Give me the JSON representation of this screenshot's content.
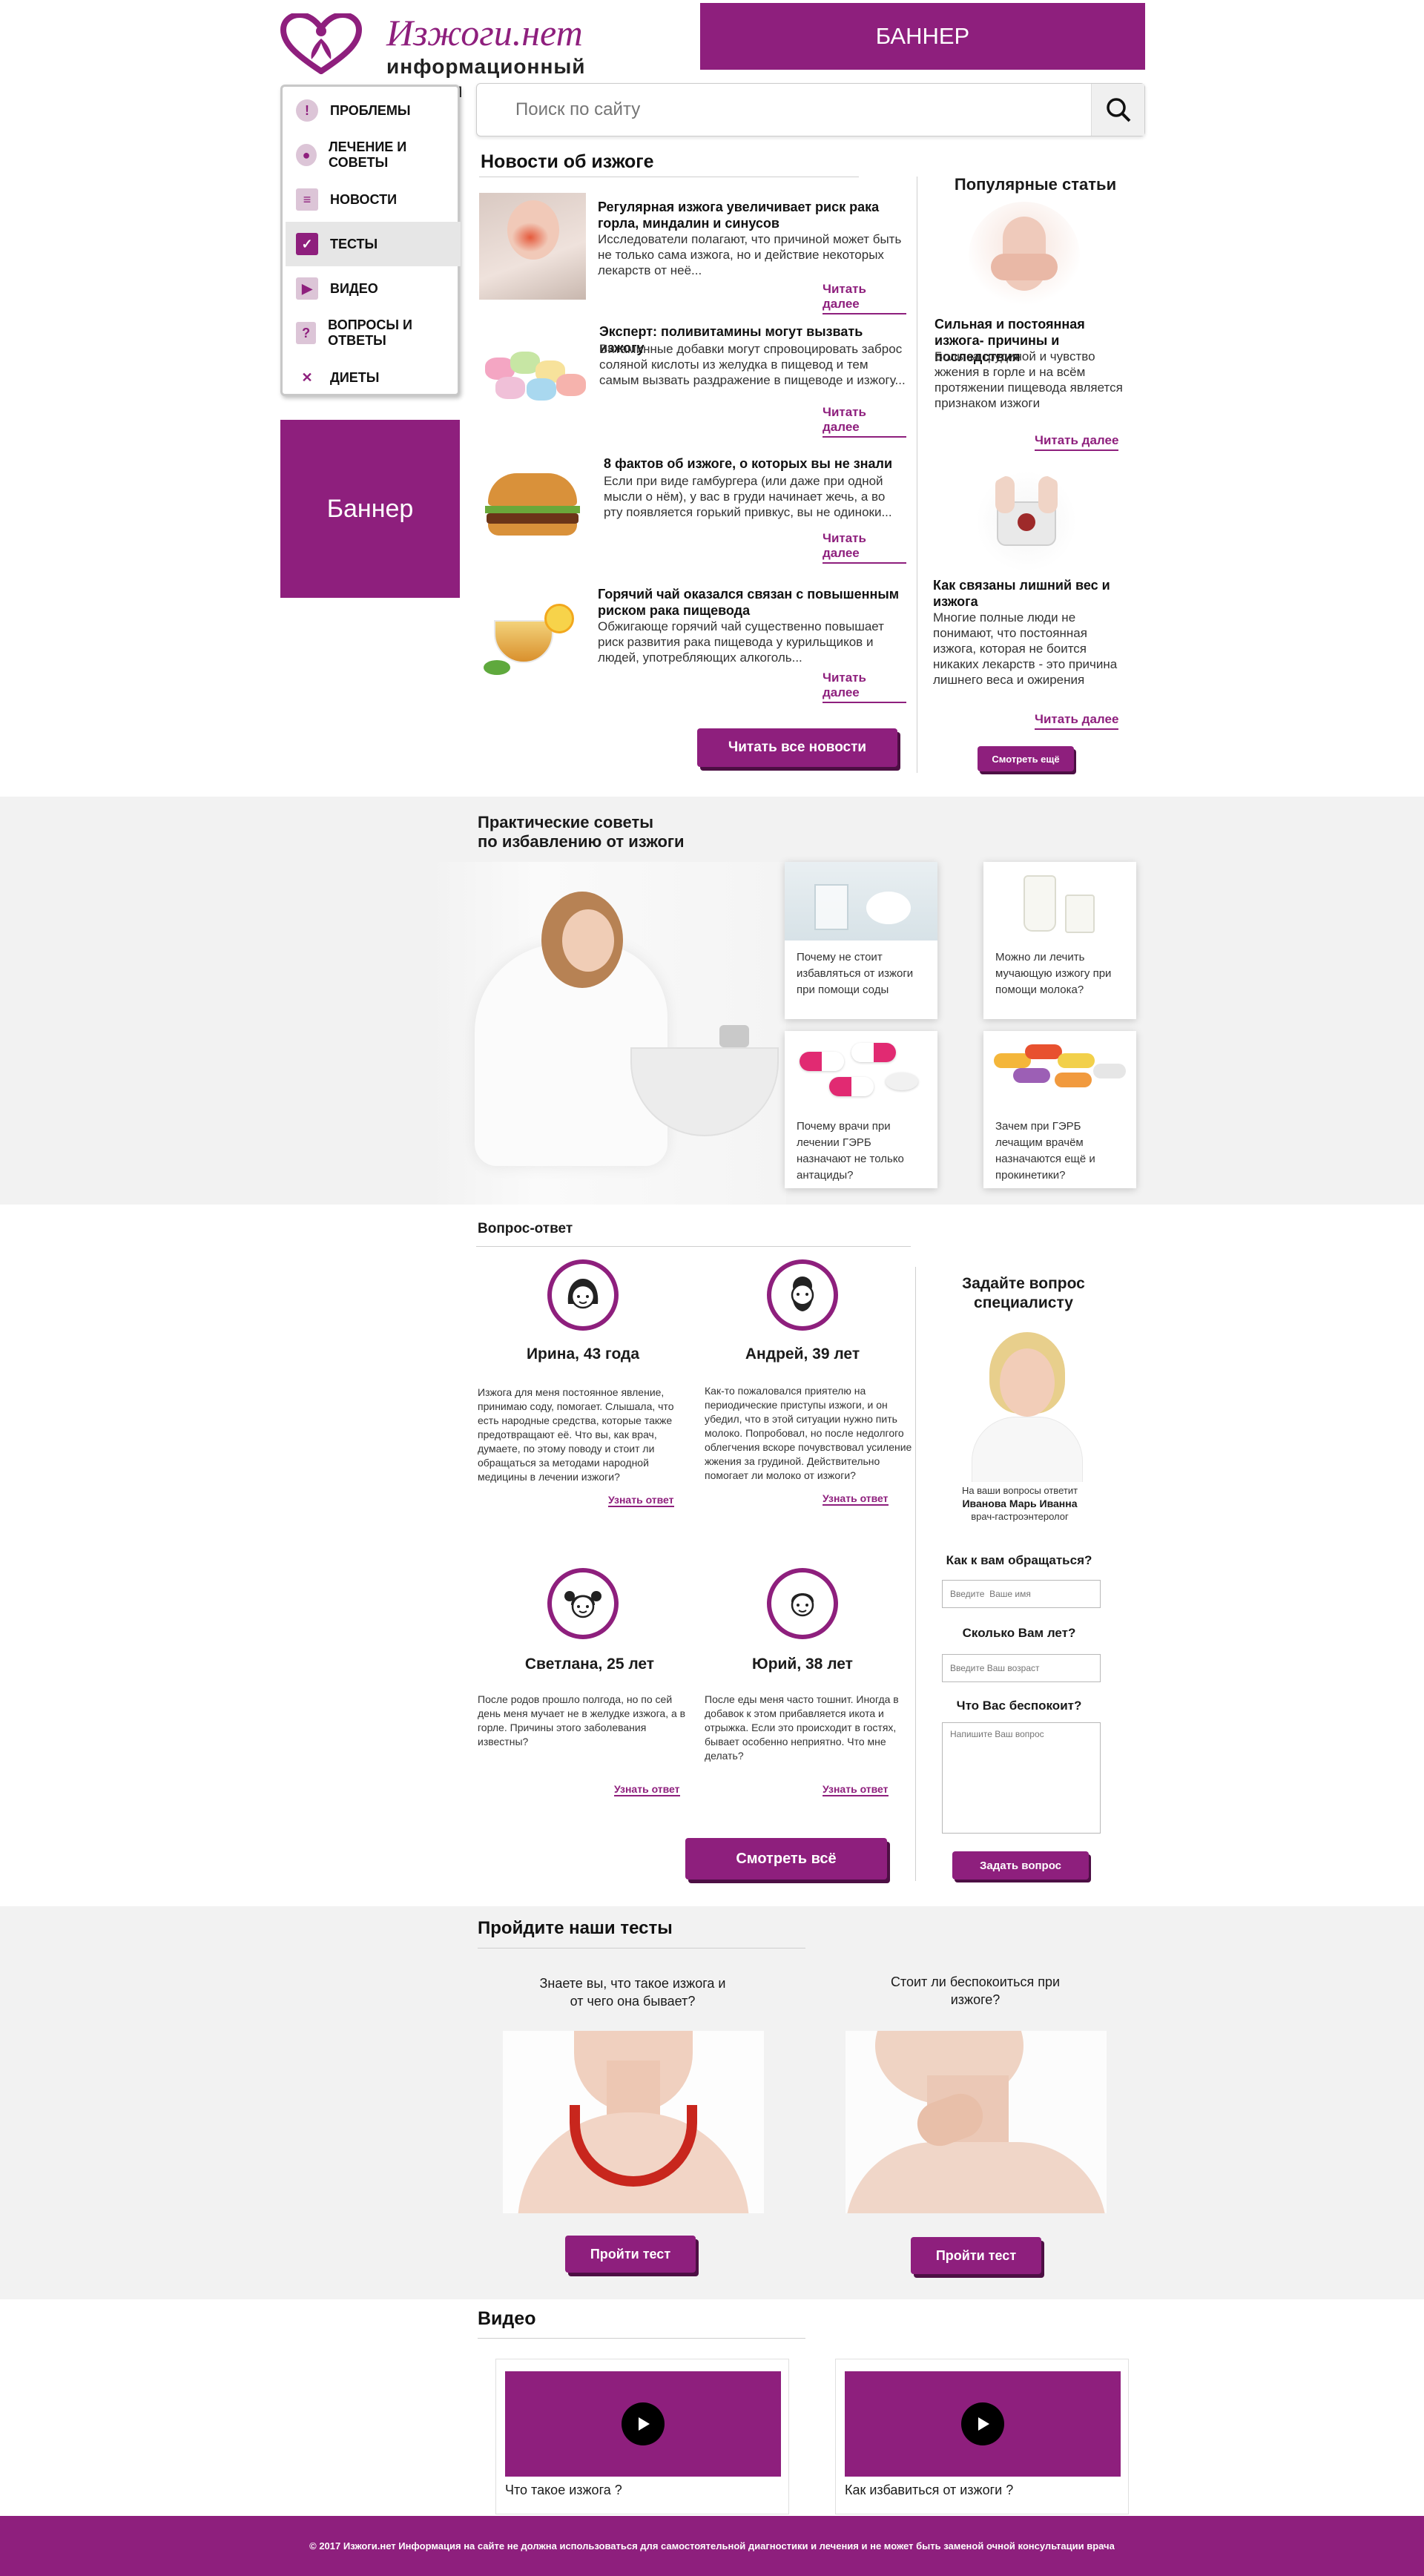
{
  "header": {
    "logo_title": "Изжоги.нет",
    "logo_subtitle": "информационный портал",
    "top_banner": "БАННЕР"
  },
  "menu": {
    "items": [
      {
        "label": "ПРОБЛЕМЫ",
        "icon": "exclamation-icon"
      },
      {
        "label": "ЛЕЧЕНИЕ И СОВЕТЫ",
        "icon": "pills-icon"
      },
      {
        "label": "НОВОСТИ",
        "icon": "newspaper-icon"
      },
      {
        "label": "ТЕСТЫ",
        "icon": "checklist-icon"
      },
      {
        "label": "ВИДЕО",
        "icon": "video-icon"
      },
      {
        "label": "ВОПРОСЫ И ОТВЕТЫ",
        "icon": "question-icon"
      },
      {
        "label": "ДИЕТЫ",
        "icon": "cutlery-icon"
      }
    ],
    "active_index": 3
  },
  "side_banner": "Баннер",
  "search": {
    "placeholder": "Поиск по сайту"
  },
  "news": {
    "heading": "Новости об изжоге",
    "items": [
      {
        "title": "Регулярная изжога увеличивает риск рака горла, миндалин и синусов",
        "text": "Исследователи полагают, что причиной может быть не только сама изжога, но и действие некоторых лекарств от неё...",
        "more": "Читать далее"
      },
      {
        "title": "Эксперт: поливитамины могут вызвать изжогу",
        "text": "Витаминные добавки могут спровоцировать заброс соляной кислоты из желудка в пищевод и тем самым вызвать раздражение в пищеводе и изжогу...",
        "more": "Читать далее"
      },
      {
        "title": "8 фактов об изжоге, о которых вы не знали",
        "text": "Если при виде гамбургера (или даже при одной мысли о нём), у вас в груди начинает жечь, а во рту появляется горький привкус, вы не одиноки...",
        "more": "Читать далее"
      },
      {
        "title": "Горячий чай оказался связан с повышенным риском рака пищевода",
        "text": "Обжигающе горячий чай существенно повышает риск развития рака пищевода у курильщиков и людей, употребляющих алкоголь...",
        "more": "Читать далее"
      }
    ],
    "all_button": "Читать все новости"
  },
  "popular": {
    "heading": "Популярные статьи",
    "items": [
      {
        "title": "Сильная и постоянная изжога- причины и последствия",
        "text": "Боль за грудиной и чувство жжения в горле и на всём протяжении пищевода является признаком изжоги",
        "more": "Читать далее"
      },
      {
        "title": "Как связаны лишний вес и изжога",
        "text": "Многие полные люди не понимают, что постоянная изжога, которая не боится никаких лекарств - это причина лишнего веса и ожирения",
        "more": "Читать далее"
      }
    ],
    "more_button": "Смотреть ещё"
  },
  "tips": {
    "heading_line1": "Практические советы",
    "heading_line2": "по избавлению от изжоги",
    "cards": [
      {
        "text": "Почему не стоит избавляться от изжоги при помощи соды"
      },
      {
        "text": "Можно ли лечить мучающую изжогу при помощи молока?"
      },
      {
        "text": "Почему врачи при лечении ГЭРБ назначают не только антациды?"
      },
      {
        "text": "Зачем  при ГЭРБ лечащим врачём назначаются ещё и прокинетики?"
      }
    ]
  },
  "qa": {
    "heading": "Вопрос-ответ",
    "items": [
      {
        "name": "Ирина, 43 года",
        "text": "Изжога для меня постоянное явление, принимаю соду, помогает. Слышала, что есть народные средства, которые также предотвращают её. Что вы, как врач, думаете, по этому поводу и стоит ли обращаться за методами народной медицины в лечении изжоги?",
        "more": "Узнать ответ"
      },
      {
        "name": "Андрей, 39 лет",
        "text": "Как-то пожаловался приятелю на периодические приступы изжоги, и он убедил, что в этой ситуации нужно пить молоко. Попробовал, но после недолгого облегчения вскоре почувствовал усиление жжения за грудиной. Действительно помогает ли молоко от изжоги?",
        "more": "Узнать ответ"
      },
      {
        "name": "Светлана, 25 лет",
        "text": "После родов прошло полгода, но по сей день меня мучает не в желудке изжога, а в горле. Причины этого заболевания известны?",
        "more": "Узнать ответ"
      },
      {
        "name": "Юрий, 38 лет",
        "text": "После еды меня часто тошнит. Иногда в добавок к этом прибавляется икота и отрыжка. Если это происходит в гостях, бывает особенно неприятно. Что мне делать?",
        "more": "Узнать ответ"
      }
    ],
    "all_button": "Смотреть всё"
  },
  "ask": {
    "heading": "Задайте вопрос специалисту",
    "answered_by": "На ваши вопросы ответит",
    "doctor_name": "Иванова Марь Иванна",
    "doctor_role": "врач-гастроэнтеролог",
    "name_label": "Как к вам обращаться?",
    "name_placeholder": "Введите  Ваше имя",
    "age_label": "Сколько Вам лет?",
    "age_placeholder": "Введите Ваш возраст",
    "question_label": "Что Вас беспокоит?",
    "question_placeholder": "Напишите Ваш вопрос",
    "submit": "Задать вопрос"
  },
  "tests": {
    "heading": "Пройдите наши тесты",
    "items": [
      {
        "title": "Знаете вы, что такое изжога и от чего она бывает?",
        "button": "Пройти тест"
      },
      {
        "title": "Стоит ли беспокоиться при изжоге?",
        "button": "Пройти тест"
      }
    ]
  },
  "videos": {
    "heading": "Видео",
    "items": [
      {
        "title": "Что такое изжога ?"
      },
      {
        "title": "Как избавиться от изжоги ?"
      }
    ]
  },
  "footer": {
    "text": "© 2017 Изжоги.нет Информация на сайте не должна использоваться для самостоятельной диагностики и лечения и не может быть заменой очной консультации врача"
  },
  "colors": {
    "accent": "#8e1f7d",
    "accent_dark": "#4d0f44",
    "section_bg": "#f2f2f2"
  }
}
